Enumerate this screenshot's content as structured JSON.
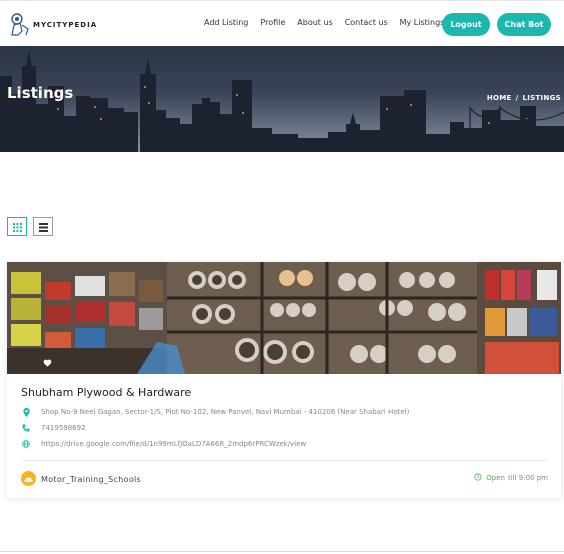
{
  "header": {
    "logo_text": "MYCITYPEDIA",
    "nav": [
      "Add Listing",
      "Profile",
      "About us",
      "Contact us",
      "My Listings"
    ],
    "logout_label": "Logout",
    "chat_label": "Chat Bot"
  },
  "hero": {
    "title": "Listings",
    "breadcrumb_home": "HOME",
    "breadcrumb_sep": "/",
    "breadcrumb_current": "LISTINGS"
  },
  "listing": {
    "title": "Shubham Plywood & Hardware",
    "address": "Shop No-9 Neel Gagan, Sector-1/S, Plot No-102, New Panvel, Navi Mumbai - 410206 (Near Shabari Hotel)",
    "phone": "7419598692",
    "website": "https://drive.google.com/file/d/1n99mLfJOaLD7A66R_2mdp6rPRCWzek/view",
    "category": "Motor_Training_Schools",
    "status_open": "Open",
    "status_till": "till 9:00 pm"
  },
  "colors": {
    "accent": "#1bb8b0",
    "category_badge": "#f6b31c",
    "open_status": "#4caf50"
  },
  "icons": [
    "logo-icon",
    "grid-view-icon",
    "list-view-icon",
    "heart-icon",
    "map-pin-icon",
    "phone-icon",
    "globe-icon",
    "car-icon",
    "clock-icon"
  ]
}
